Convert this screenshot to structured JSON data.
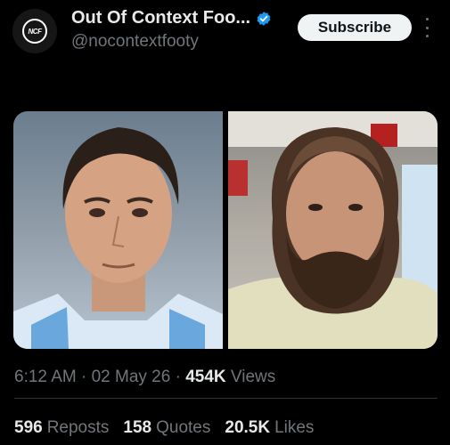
{
  "post": {
    "author": {
      "display_name": "Out Of Context Foo...",
      "handle": "@nocontextfooty",
      "avatar_text": "NCF",
      "verified": true
    },
    "subscribe_label": "Subscribe",
    "timestamp": "6:12 AM · 02 May 26 ·",
    "views_count": "454K",
    "views_label": "Views",
    "reposts_count": "596",
    "reposts_label": "Reposts",
    "quotes_count": "158",
    "quotes_label": "Quotes",
    "likes_count": "20.5K",
    "likes_label": "Likes"
  },
  "colors": {
    "background": "#000000",
    "text_primary": "#e7e9ea",
    "text_secondary": "#71767b",
    "verified_blue": "#1d9bf0",
    "divider": "#2f3336"
  }
}
